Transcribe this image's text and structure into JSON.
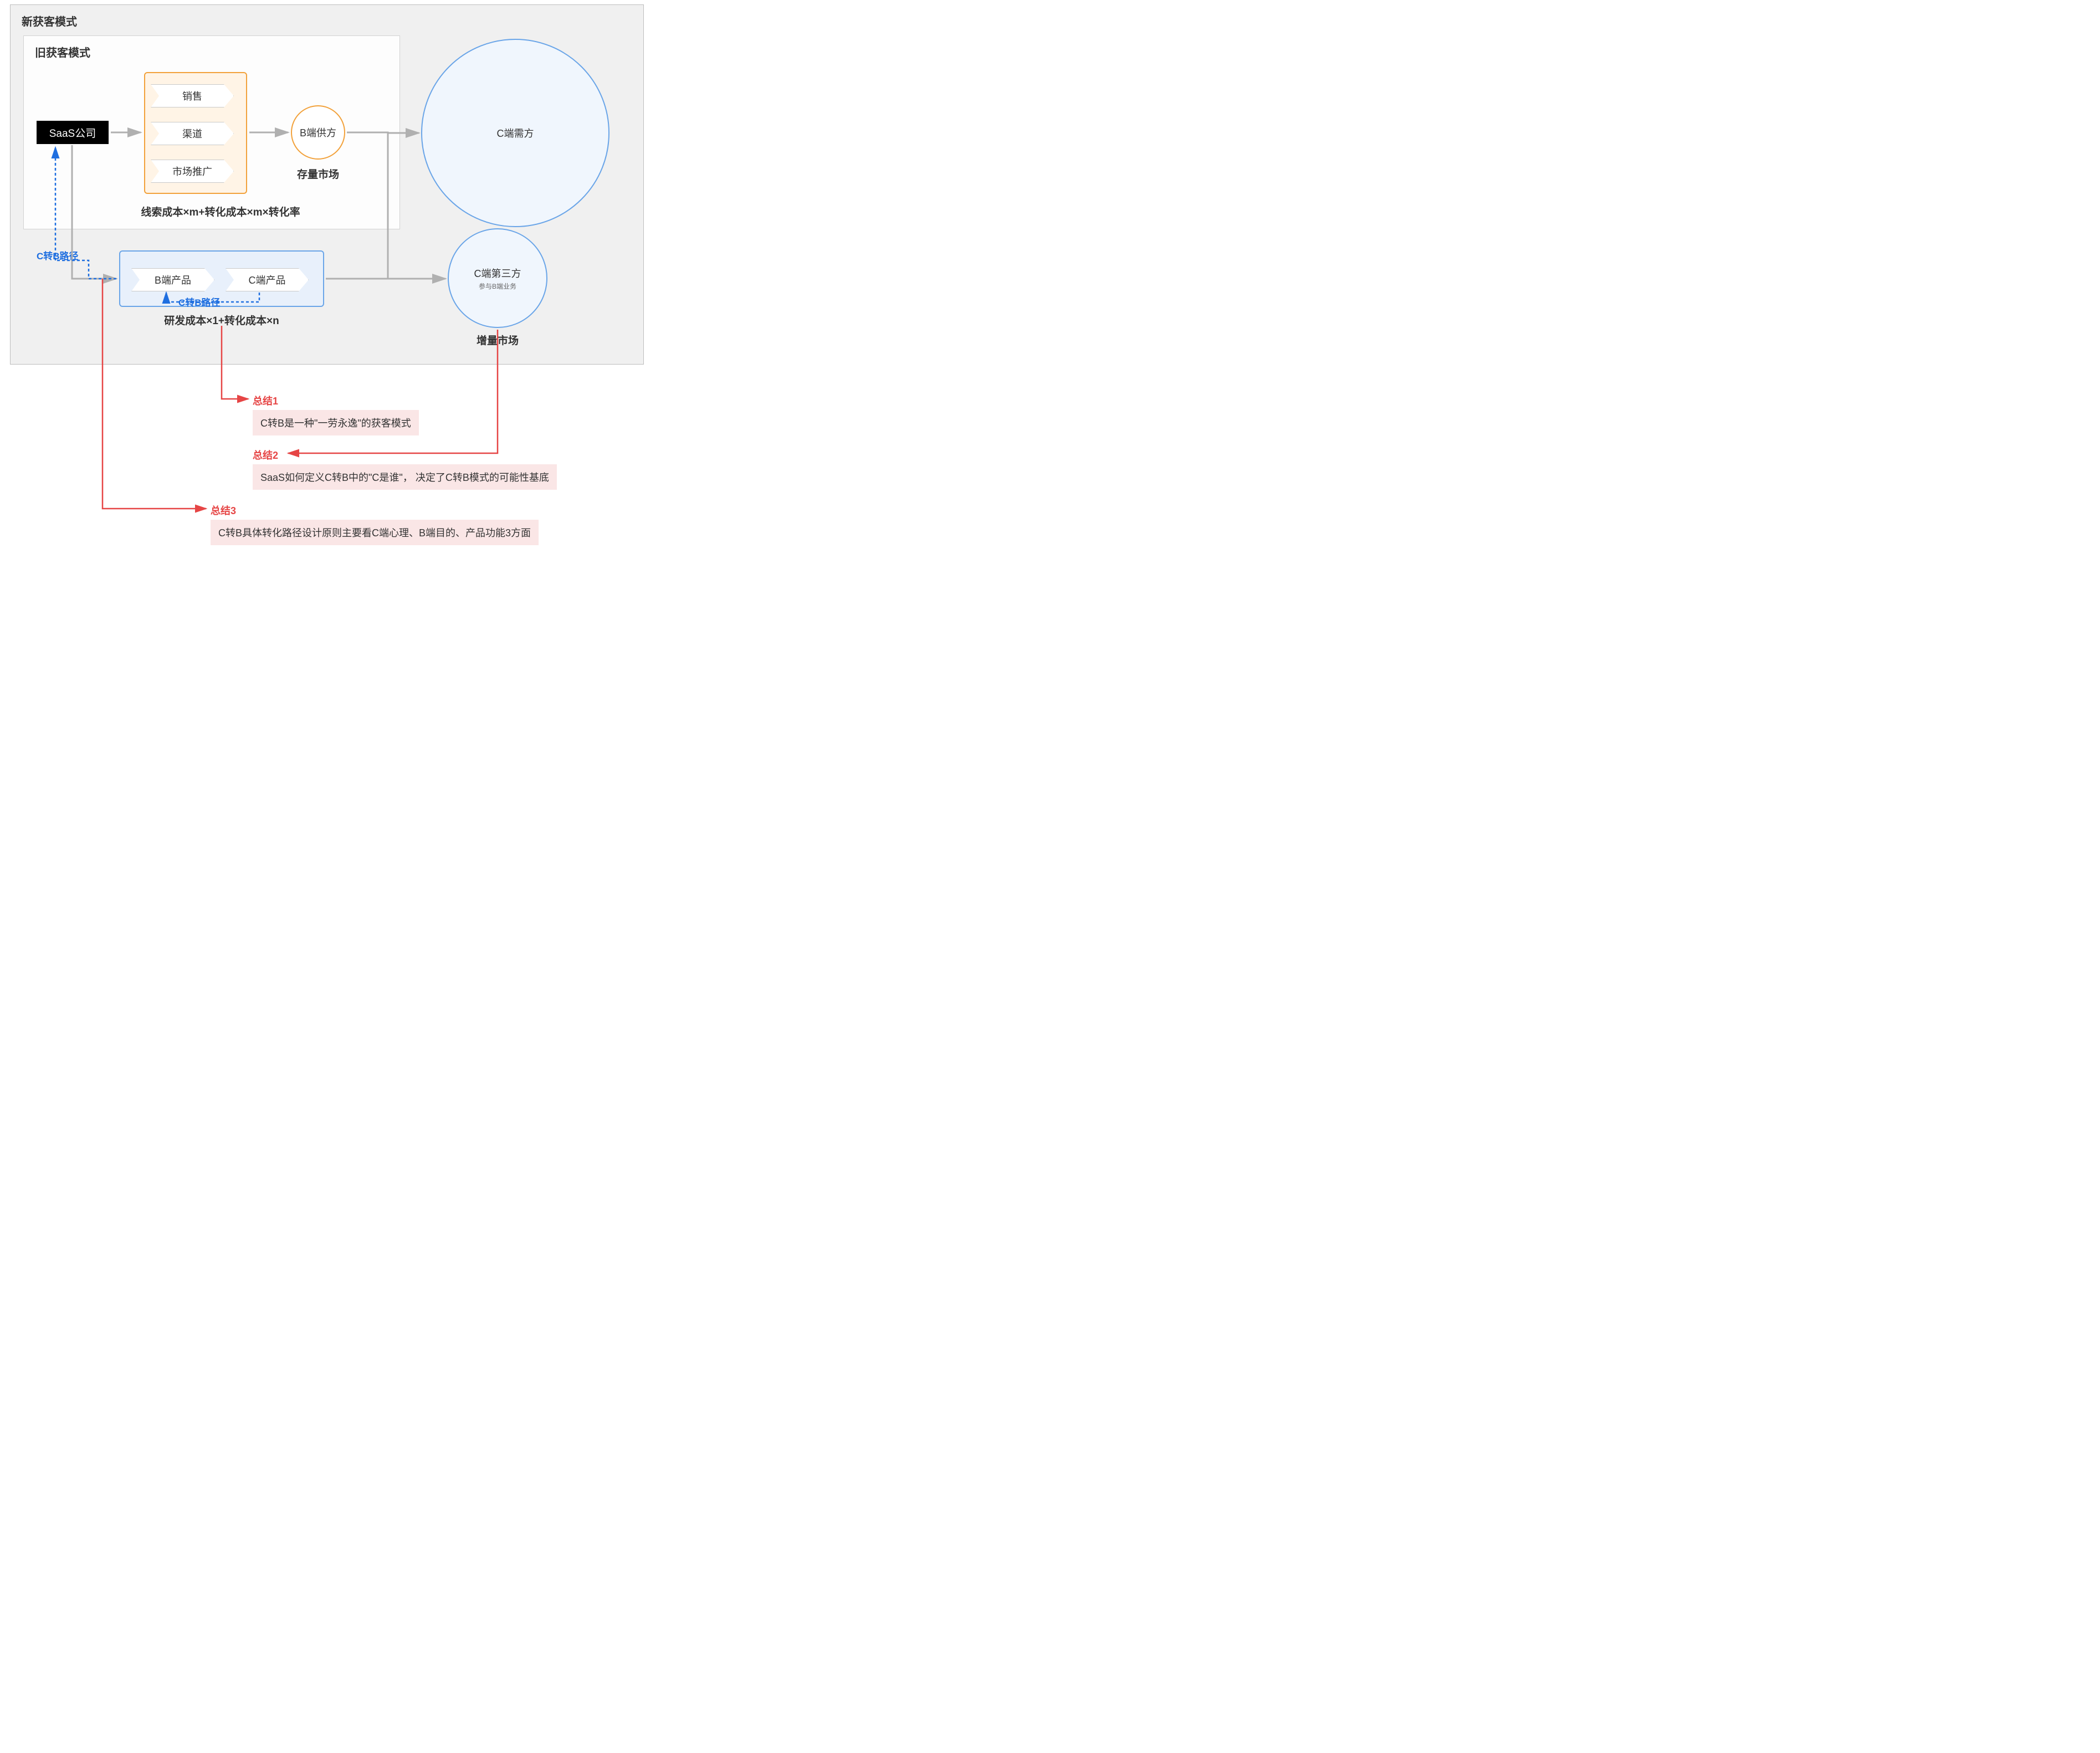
{
  "outer": {
    "title": "新获客模式"
  },
  "inner": {
    "title": "旧获客模式"
  },
  "saas": {
    "label": "SaaS公司"
  },
  "channels": {
    "items": [
      "销售",
      "渠道",
      "市场推广"
    ]
  },
  "b_supply": {
    "label": "B端供方",
    "caption": "存量市场"
  },
  "old_formula": "线索成本×m+转化成本×m×转化率",
  "products": {
    "b": "B端产品",
    "c": "C端产品"
  },
  "new_formula": "研发成本×1+转化成本×n",
  "c_demand": {
    "label": "C端需方"
  },
  "c_third": {
    "label": "C端第三方",
    "sub": "参与B端业务",
    "caption": "增量市场"
  },
  "c2b": {
    "label1": "C转B路径",
    "label2": "C转B路径"
  },
  "summary1": {
    "label": "总结1",
    "text": "C转B是一种\"一劳永逸\"的获客模式"
  },
  "summary2": {
    "label": "总结2",
    "text": "SaaS如何定义C转B中的\"C是谁\"， 决定了C转B模式的可能性基底"
  },
  "summary3": {
    "label": "总结3",
    "text": "C转B具体转化路径设计原则主要看C端心理、B端目的、产品功能3方面"
  }
}
